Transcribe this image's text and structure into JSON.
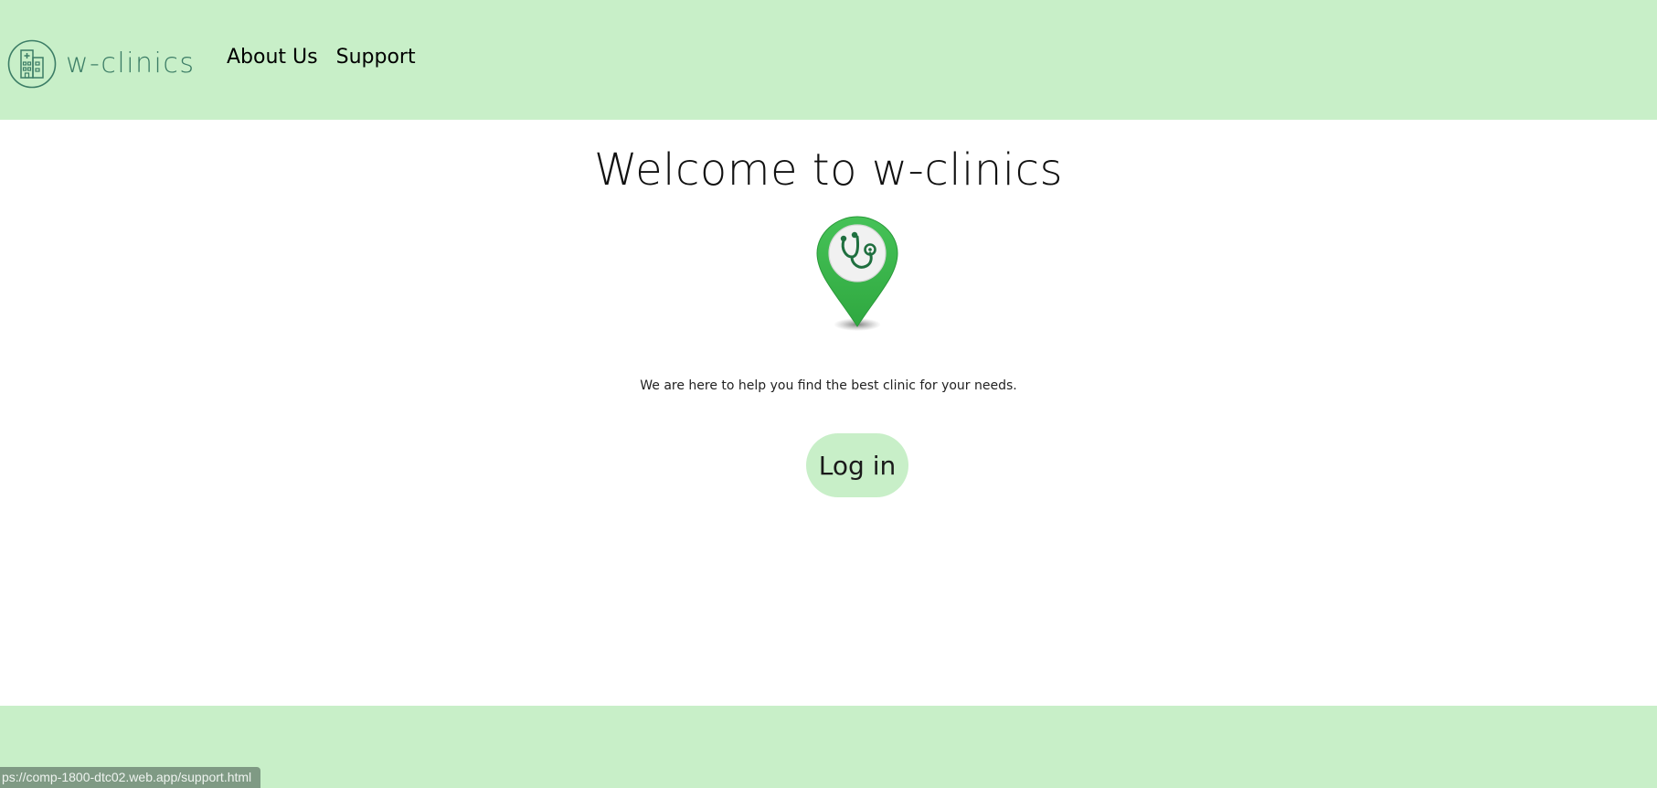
{
  "header": {
    "brand_name": "w-clinics",
    "logo_icon": "hospital-building-icon",
    "nav": [
      {
        "label": "About Us"
      },
      {
        "label": "Support"
      }
    ]
  },
  "main": {
    "title": "Welcome to w-clinics",
    "hero_icon": "stethoscope-map-pin-icon",
    "tagline": "We are here to help you find the best clinic for your needs.",
    "login_label": "Log in"
  },
  "status_bar": {
    "url": "ps://comp-1800-dtc02.web.app/support.html"
  },
  "colors": {
    "header_bg": "#c8efc8",
    "brand_text": "#3c7d66",
    "pin_green": "#3bb44a",
    "stethoscope": "#1f6f3f"
  }
}
